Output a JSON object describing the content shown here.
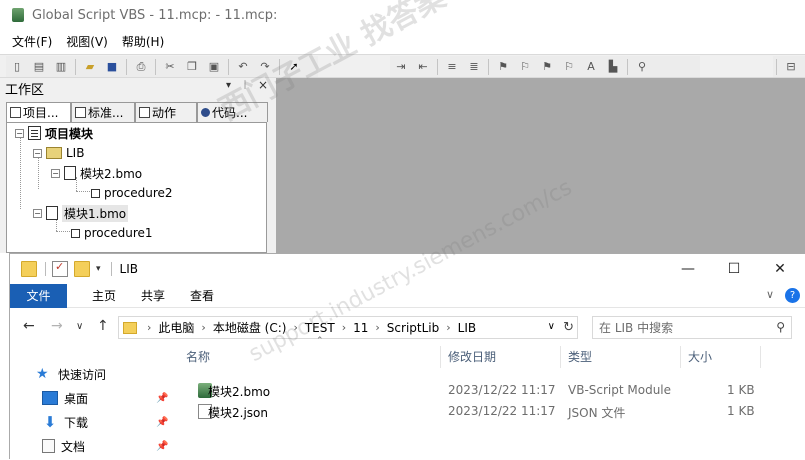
{
  "gs_window": {
    "title": "Global Script VBS - 11.mcp: - 11.mcp:",
    "menu": [
      "文件(F)",
      "视图(V)",
      "帮助(H)"
    ]
  },
  "workspace": {
    "title": "工作区",
    "pin": "▾",
    "pin2": "ᛁ",
    "close": "×",
    "tabs": [
      "项目...",
      "标准...",
      "动作",
      "代码..."
    ],
    "tree": {
      "root": "项目模块",
      "lib": "LIB",
      "module2": "模块2.bmo",
      "proc2": "procedure2",
      "module1": "模块1.bmo",
      "proc1": "procedure1"
    }
  },
  "explorer": {
    "title": "LIB",
    "qa_drop": "▾",
    "minimize": "—",
    "maximize": "☐",
    "close": "✕",
    "ribbon": {
      "file": "文件",
      "home": "主页",
      "share": "共享",
      "view": "查看",
      "expand": "∨",
      "help": "?"
    },
    "nav": {
      "back": "←",
      "forward": "→",
      "recent": "∨",
      "up": "↑"
    },
    "address": [
      "此电脑",
      "本地磁盘 (C:)",
      "TEST",
      "11",
      "ScriptLib",
      "LIB"
    ],
    "address_sep": "›",
    "search_placeholder": "在 LIB 中搜索",
    "quick_access": [
      {
        "label": "快速访问"
      },
      {
        "label": "桌面"
      },
      {
        "label": "下载"
      },
      {
        "label": "文档"
      }
    ],
    "columns": {
      "name": "名称",
      "date": "修改日期",
      "type": "类型",
      "size": "大小"
    },
    "files": [
      {
        "name": "模块2.bmo",
        "date": "2023/12/22 11:17",
        "type": "VB-Script Module",
        "size": "1 KB"
      },
      {
        "name": "模块2.json",
        "date": "2023/12/22 11:17",
        "type": "JSON 文件",
        "size": "1 KB"
      }
    ]
  },
  "watermark": {
    "line1": "西门子工业  找答案",
    "line2": "support.industry.siemens.com/cs"
  }
}
